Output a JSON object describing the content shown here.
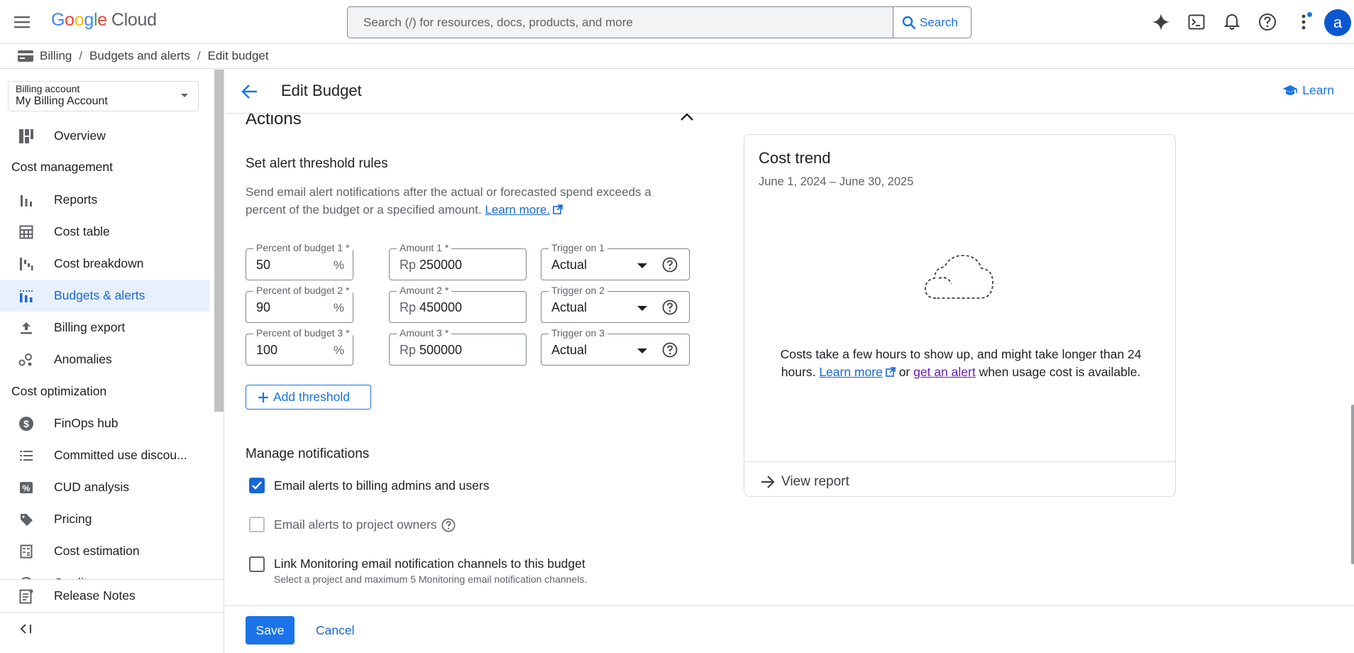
{
  "topbar": {
    "logo_g1": "G",
    "logo_o1": "o",
    "logo_o2": "o",
    "logo_g2": "g",
    "logo_l": "l",
    "logo_e": "e",
    "logo_cloud": "Cloud",
    "search_placeholder": "Search (/) for resources, docs, products, and more",
    "search_button": "Search",
    "avatar_letter": "a",
    "icons": [
      "menu-icon",
      "gemini-icon",
      "cloud-shell-icon",
      "notifications-icon",
      "help-icon",
      "more-vert-icon"
    ]
  },
  "breadcrumb": {
    "items": [
      "Billing",
      "Budgets and alerts",
      "Edit budget"
    ],
    "separator": "/"
  },
  "sidebar": {
    "billing_account_label": "Billing account",
    "billing_account_value": "My Billing Account",
    "overview": "Overview",
    "section_cost_management": "Cost management",
    "items_cost_management": [
      "Reports",
      "Cost table",
      "Cost breakdown",
      "Budgets & alerts",
      "Billing export",
      "Anomalies"
    ],
    "section_cost_optimization": "Cost optimization",
    "items_cost_optimization": [
      "FinOps hub",
      "Committed use discou...",
      "CUD analysis",
      "Pricing",
      "Cost estimation",
      "Credits"
    ],
    "release_notes": "Release Notes",
    "active_item": "Budgets & alerts",
    "collapse_glyph": "<|"
  },
  "header": {
    "title": "Edit Budget",
    "learn": "Learn"
  },
  "actions": {
    "title": "Actions",
    "threshold_heading": "Set alert threshold rules",
    "description": "Send email alert notifications after the actual or forecasted spend exceeds a percent of the budget or a specified amount.",
    "learn_more": "Learn more.",
    "thresholds": [
      {
        "percent_label": "Percent of budget 1 *",
        "percent": "50",
        "percent_suffix": "%",
        "amount_label": "Amount 1 *",
        "currency": "Rp",
        "amount": "250000",
        "trigger_label": "Trigger on 1",
        "trigger": "Actual"
      },
      {
        "percent_label": "Percent of budget 2 *",
        "percent": "90",
        "percent_suffix": "%",
        "amount_label": "Amount 2 *",
        "currency": "Rp",
        "amount": "450000",
        "trigger_label": "Trigger on 2",
        "trigger": "Actual"
      },
      {
        "percent_label": "Percent of budget 3 *",
        "percent": "100",
        "percent_suffix": "%",
        "amount_label": "Amount 3 *",
        "currency": "Rp",
        "amount": "500000",
        "trigger_label": "Trigger on 3",
        "trigger": "Actual"
      }
    ],
    "add_threshold": "Add threshold",
    "notifications_heading": "Manage notifications",
    "notify_admins": "Email alerts to billing admins and users",
    "notify_admins_checked": true,
    "notify_owners": "Email alerts to project owners",
    "notify_owners_checked": false,
    "link_monitoring": "Link Monitoring email notification channels to this budget",
    "link_monitoring_sub": "Select a project and maximum 5 Monitoring email notification channels.",
    "link_monitoring_checked": false
  },
  "cost_trend": {
    "title": "Cost trend",
    "range": "June 1, 2024 – June 30, 2025",
    "msg_part1": "Costs take a few hours to show up, and might take longer than 24 hours.",
    "learn_more": "Learn more",
    "msg_or": "or",
    "get_alert": "get an alert",
    "msg_part2": "when usage cost is available.",
    "view_report": "View report"
  },
  "footer": {
    "save": "Save",
    "cancel": "Cancel"
  },
  "colors": {
    "accent": "#1a73e8",
    "active_bg": "#e8f0fe",
    "visited_link": "#681da8"
  }
}
